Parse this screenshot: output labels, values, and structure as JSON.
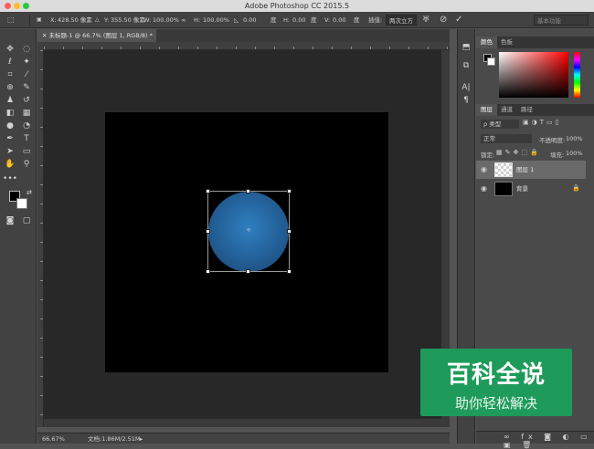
{
  "window": {
    "title": "Adobe Photoshop CC 2015.5"
  },
  "options_bar": {
    "x_label": "X:",
    "x_value": "428.50 像素",
    "y_label": "Y:",
    "y_value": "355.50 像素",
    "w_label": "W:",
    "w_value": "100.00%",
    "h_label": "H:",
    "h_value": "100.00%",
    "angle_value": "0.00",
    "angle_unit": "度",
    "hskew_label": "H:",
    "hskew_value": "0.00",
    "vskew_unit": "度",
    "vskew_label": "V:",
    "vskew_value": "0.00",
    "interp_label": "插值:",
    "interp_value": "两次立方",
    "workspace_value": "基本功能"
  },
  "document": {
    "tab_label": "未标题-1 @ 66.7% (图层 1, RGB/8) *"
  },
  "status": {
    "zoom": "66.67%",
    "doc_info": "文档:1.86M/2.51M"
  },
  "panels": {
    "color_tabs": [
      "颜色",
      "色板"
    ],
    "layer_tabs": [
      "图层",
      "通道",
      "路径"
    ],
    "kind_filter": "ρ 类型",
    "blend_mode": "正常",
    "opacity_label": "不透明度:",
    "opacity_value": "100%",
    "lock_label": "锁定:",
    "fill_label": "填充:",
    "fill_value": "100%",
    "layers": [
      {
        "name": "图层 1"
      },
      {
        "name": "背景"
      }
    ]
  },
  "watermark": {
    "line1": "百科全说",
    "line2": "助你轻松解决"
  }
}
